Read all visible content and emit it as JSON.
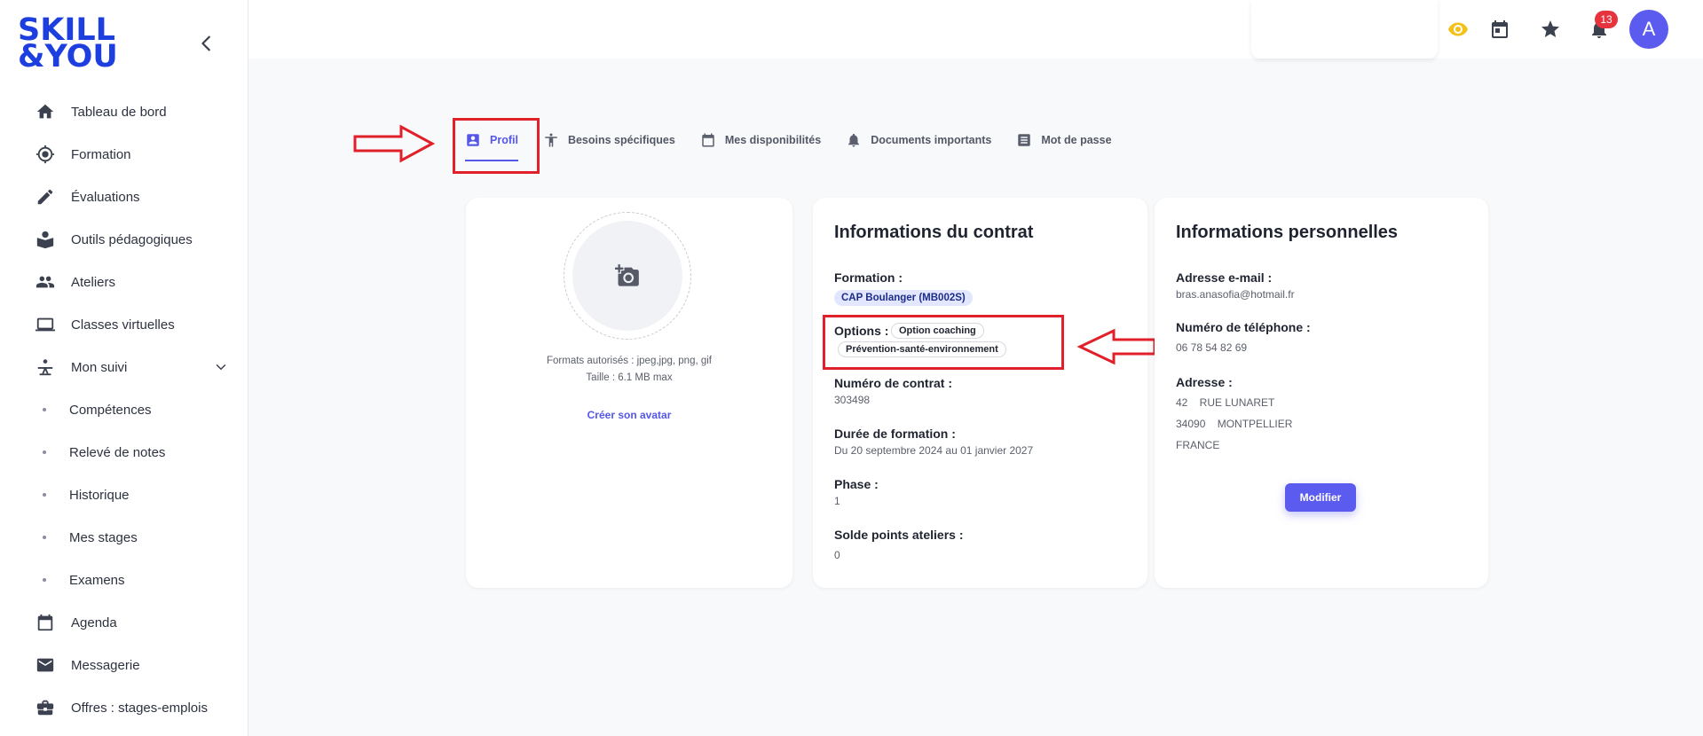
{
  "brand": {
    "line1": "SKILL",
    "line2": "&YOU",
    "color": "#1e3fe0"
  },
  "sidebar": {
    "items": [
      {
        "label": "Tableau de bord",
        "icon": "home-icon"
      },
      {
        "label": "Formation",
        "icon": "target-icon"
      },
      {
        "label": "Évaluations",
        "icon": "pencil-icon"
      },
      {
        "label": "Outils pédagogiques",
        "icon": "book-user-icon"
      },
      {
        "label": "Ateliers",
        "icon": "people-icon"
      },
      {
        "label": "Classes virtuelles",
        "icon": "laptop-icon"
      },
      {
        "label": "Mon suivi",
        "icon": "follow-icon"
      },
      {
        "label": "Compétences"
      },
      {
        "label": "Relevé de notes"
      },
      {
        "label": "Historique"
      },
      {
        "label": "Mes stages"
      },
      {
        "label": "Examens"
      },
      {
        "label": "Agenda",
        "icon": "calendar-icon"
      },
      {
        "label": "Messagerie",
        "icon": "mail-icon"
      },
      {
        "label": "Offres : stages-emplois",
        "icon": "briefcase-icon"
      }
    ]
  },
  "header": {
    "notification_count": "13",
    "avatar_initial": "A",
    "colors": {
      "eye": "#f2c21b",
      "accent": "#5b5bf0",
      "badge": "#e5343d"
    }
  },
  "tabs": [
    {
      "label": "Profil",
      "icon": "profile-icon",
      "active": true
    },
    {
      "label": "Besoins spécifiques",
      "icon": "accessibility-icon"
    },
    {
      "label": "Mes disponibilités",
      "icon": "calendar-icon"
    },
    {
      "label": "Documents importants",
      "icon": "bell-icon"
    },
    {
      "label": "Mot de passe",
      "icon": "document-icon"
    }
  ],
  "avatar_card": {
    "formats": "Formats autorisés : jpeg,jpg, png, gif",
    "size": "Taille : 6.1 MB max",
    "create_link": "Créer son avatar"
  },
  "contract": {
    "title": "Informations du contrat",
    "formation_label": "Formation :",
    "formation_value": "CAP Boulanger (MB002S)",
    "options_label": "Options :",
    "options": [
      "Option coaching",
      "Prévention-santé-environnement"
    ],
    "contract_number_label": "Numéro de contrat :",
    "contract_number": "303498",
    "duration_label": "Durée de formation :",
    "duration": "Du 20 septembre 2024 au 01 janvier 2027",
    "phase_label": "Phase :",
    "phase": "1",
    "points_label": "Solde points ateliers :",
    "points": "0"
  },
  "personal": {
    "title": "Informations personnelles",
    "email_label": "Adresse e-mail :",
    "email": "bras.anasofia@hotmail.fr",
    "phone_label": "Numéro de téléphone :",
    "phone": "06 78 54 82 69",
    "address_label": "Adresse :",
    "address_line1": "42    RUE LUNARET",
    "address_line2": "34090    MONTPELLIER",
    "address_line3": "FRANCE",
    "modify_label": "Modifier"
  }
}
